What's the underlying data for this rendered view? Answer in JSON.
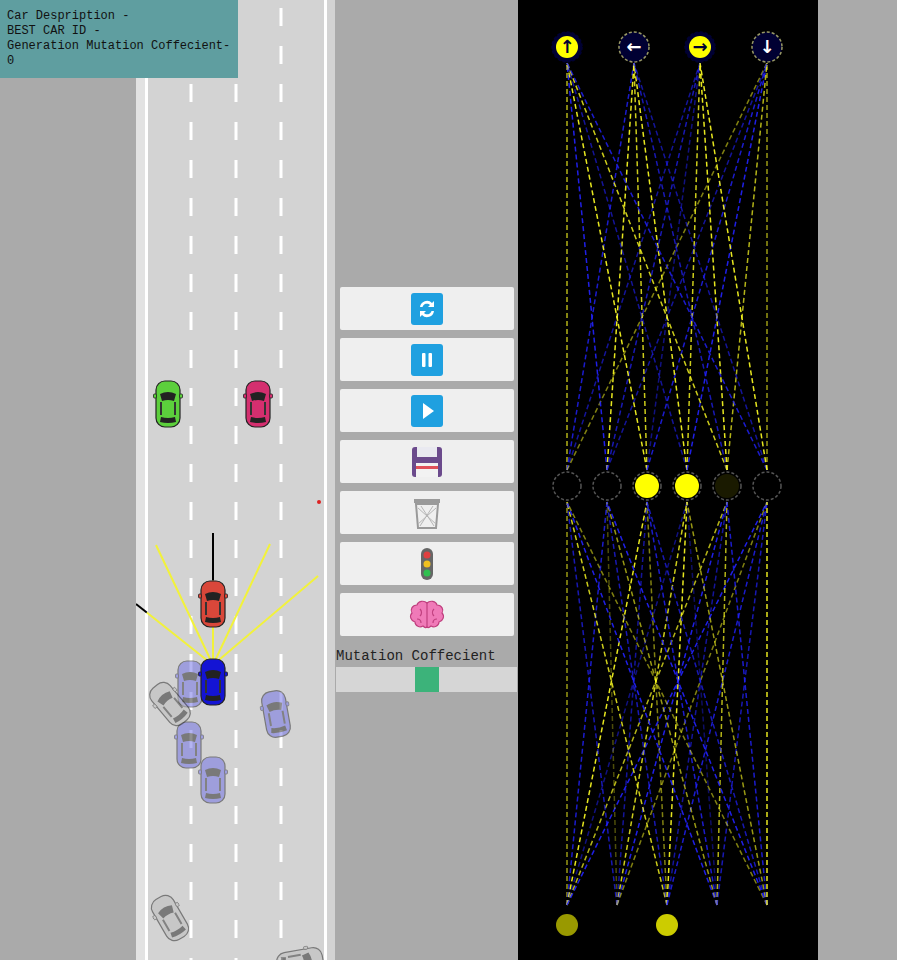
{
  "info": {
    "lines": [
      "Car Despription -",
      "BEST CAR ID -",
      "Generation Mutation Coffecient-",
      "0"
    ]
  },
  "cars": [
    {
      "kind": "traffic",
      "color": "#5ccf3c"
    },
    {
      "kind": "traffic",
      "color": "#d42f6f"
    },
    {
      "kind": "traffic",
      "color": "#d9473a"
    },
    {
      "kind": "best",
      "color": "#1414d4"
    },
    {
      "kind": "ghost",
      "color": "#6b6be6"
    },
    {
      "kind": "ghost",
      "color": "#6b6be6"
    },
    {
      "kind": "ghost",
      "color": "#6b6be6"
    },
    {
      "kind": "ghost",
      "color": "#6b6be6"
    },
    {
      "kind": "ghost",
      "color": "#bdbdbd"
    },
    {
      "kind": "ghost",
      "color": "#bdbdbd"
    },
    {
      "kind": "ghost",
      "color": "#bdbdbd"
    }
  ],
  "sensors": [
    {
      "level": 0.86
    },
    {
      "level": 1
    },
    {
      "level": 0.64
    },
    {
      "level": 1
    },
    {
      "level": 1
    }
  ],
  "mutation": {
    "label": "Mutation Coffecient",
    "level": 0.5
  },
  "network": {
    "outputs": [
      {
        "label": "↑",
        "active": true
      },
      {
        "label": "←",
        "active": false
      },
      {
        "label": "→",
        "active": true
      },
      {
        "label": "↓",
        "active": false
      }
    ],
    "hidden": [
      0,
      0,
      1,
      1,
      0.1,
      0
    ],
    "inputs": [
      0.6,
      0,
      0.8,
      0,
      0
    ],
    "w1": [
      [
        0.6,
        -0.8,
        0.9,
        -0.5,
        0.7,
        -0.9
      ],
      [
        -0.7,
        0.3,
        -0.6,
        0.8,
        -0.9,
        0.5
      ],
      [
        0.8,
        -0.7,
        0.5,
        0.9,
        -0.6,
        -0.8
      ],
      [
        -0.9,
        0.6,
        -0.8,
        -0.4,
        0.7,
        -0.7
      ],
      [
        0.5,
        -0.9,
        -0.7,
        0.6,
        -0.8,
        0.9
      ]
    ],
    "w2": [
      [
        0.7,
        -0.8,
        -0.6,
        0.5
      ],
      [
        -0.9,
        0.9,
        -0.7,
        -0.6
      ],
      [
        0.9,
        0.8,
        -0.5,
        -0.8
      ],
      [
        -0.6,
        0.9,
        0.8,
        -0.9
      ],
      [
        0.8,
        -0.7,
        0.9,
        0.7
      ],
      [
        -0.8,
        -0.6,
        0.9,
        0.6
      ]
    ]
  }
}
